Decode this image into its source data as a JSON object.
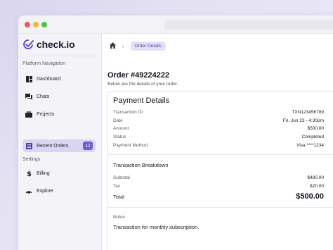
{
  "app": {
    "logo_text": "check.io"
  },
  "sidebar": {
    "section_platform": "Platform Navigation",
    "section_settings": "Settings",
    "items": [
      {
        "label": "Dashboard",
        "icon": "dashboard-icon"
      },
      {
        "label": "Chats",
        "icon": "chat-icon"
      },
      {
        "label": "Projects",
        "icon": "briefcase-icon"
      },
      {
        "label": "Recent Orders",
        "icon": "orders-icon",
        "badge": "12",
        "active": true
      },
      {
        "label": "Billing",
        "icon": "dollar-icon"
      },
      {
        "label": "Explore",
        "icon": "explore-icon"
      }
    ]
  },
  "breadcrumb": {
    "home_icon": "home-icon",
    "current": "Order Details"
  },
  "order": {
    "title": "Order #49224222",
    "subtitle": "Below are the details of your order."
  },
  "payment": {
    "title": "Payment Details",
    "rows": [
      {
        "label": "Transaction ID",
        "value": "TXN123456789"
      },
      {
        "label": "Date",
        "value": "Fri, Jun 23 - 4:30pm"
      },
      {
        "label": "Amount",
        "value": "$500.00"
      },
      {
        "label": "Status",
        "value": "Completed"
      },
      {
        "label": "Payment Method",
        "value": "Visa ****1234"
      }
    ]
  },
  "breakdown": {
    "title": "Transaction Breakdown",
    "subtotal_label": "Subtotal",
    "subtotal_value": "$480.00",
    "tax_label": "Tax",
    "tax_value": "$20.00",
    "total_label": "Total",
    "total_value": "$500.00"
  },
  "notes": {
    "label": "Notes",
    "text": "Transaction for monthly subscription."
  },
  "colors": {
    "accent": "#6b5fd3",
    "active_bg": "#d9d5f2",
    "sidebar_bg": "#f4f4f8"
  }
}
